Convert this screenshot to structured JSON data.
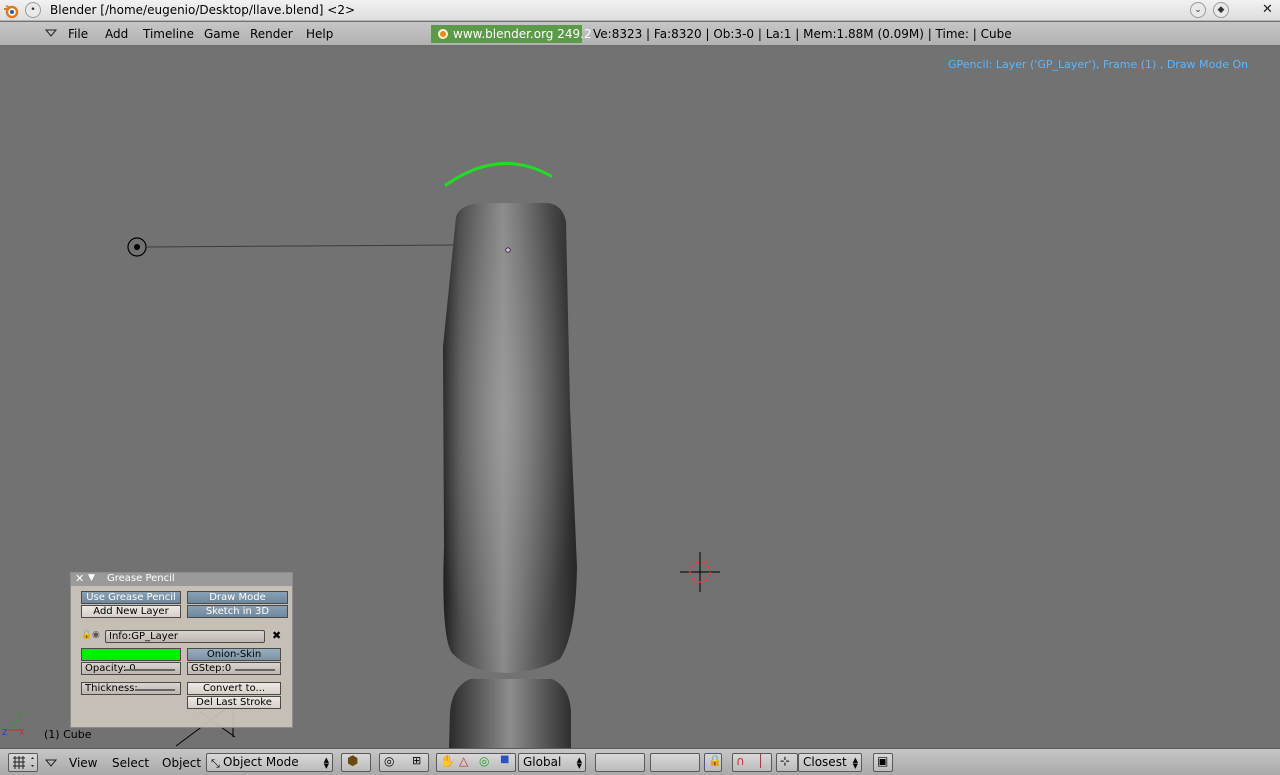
{
  "window": {
    "title": "Blender [/home/eugenio/Desktop/llave.blend] <2>"
  },
  "menubar": {
    "items": [
      "File",
      "Add",
      "Timeline",
      "Game",
      "Render",
      "Help"
    ],
    "info_url": "www.blender.org 249.2",
    "stats": "Ve:8323 | Fa:8320 | Ob:3-0 | La:1  | Mem:1.88M (0.09M)  | Time: | Cube"
  },
  "viewport": {
    "gpencil_info": "GPencil: Layer ('GP_Layer'), Frame (1) , Draw Mode On",
    "object_label": "(1) Cube",
    "stroke_color": "#22dd22"
  },
  "grease_pencil": {
    "title": "Grease Pencil",
    "use_grease_pencil": "Use Grease Pencil",
    "draw_mode": "Draw Mode",
    "add_new_layer": "Add New Layer",
    "sketch_in_3d": "Sketch in 3D",
    "layer_name": "Info:GP_Layer",
    "layer_color": "#00ee00",
    "onion_skin": "Onion-Skin",
    "opacity": "Opacity: 0",
    "gstep": "GStep:0",
    "thickness": "Thickness:",
    "convert_to": "Convert to...",
    "del_last_stroke": "Del Last Stroke"
  },
  "bottombar": {
    "view": "View",
    "select": "Select",
    "object": "Object",
    "mode": "Object Mode",
    "orientation": "Global",
    "snap": "Closest"
  }
}
